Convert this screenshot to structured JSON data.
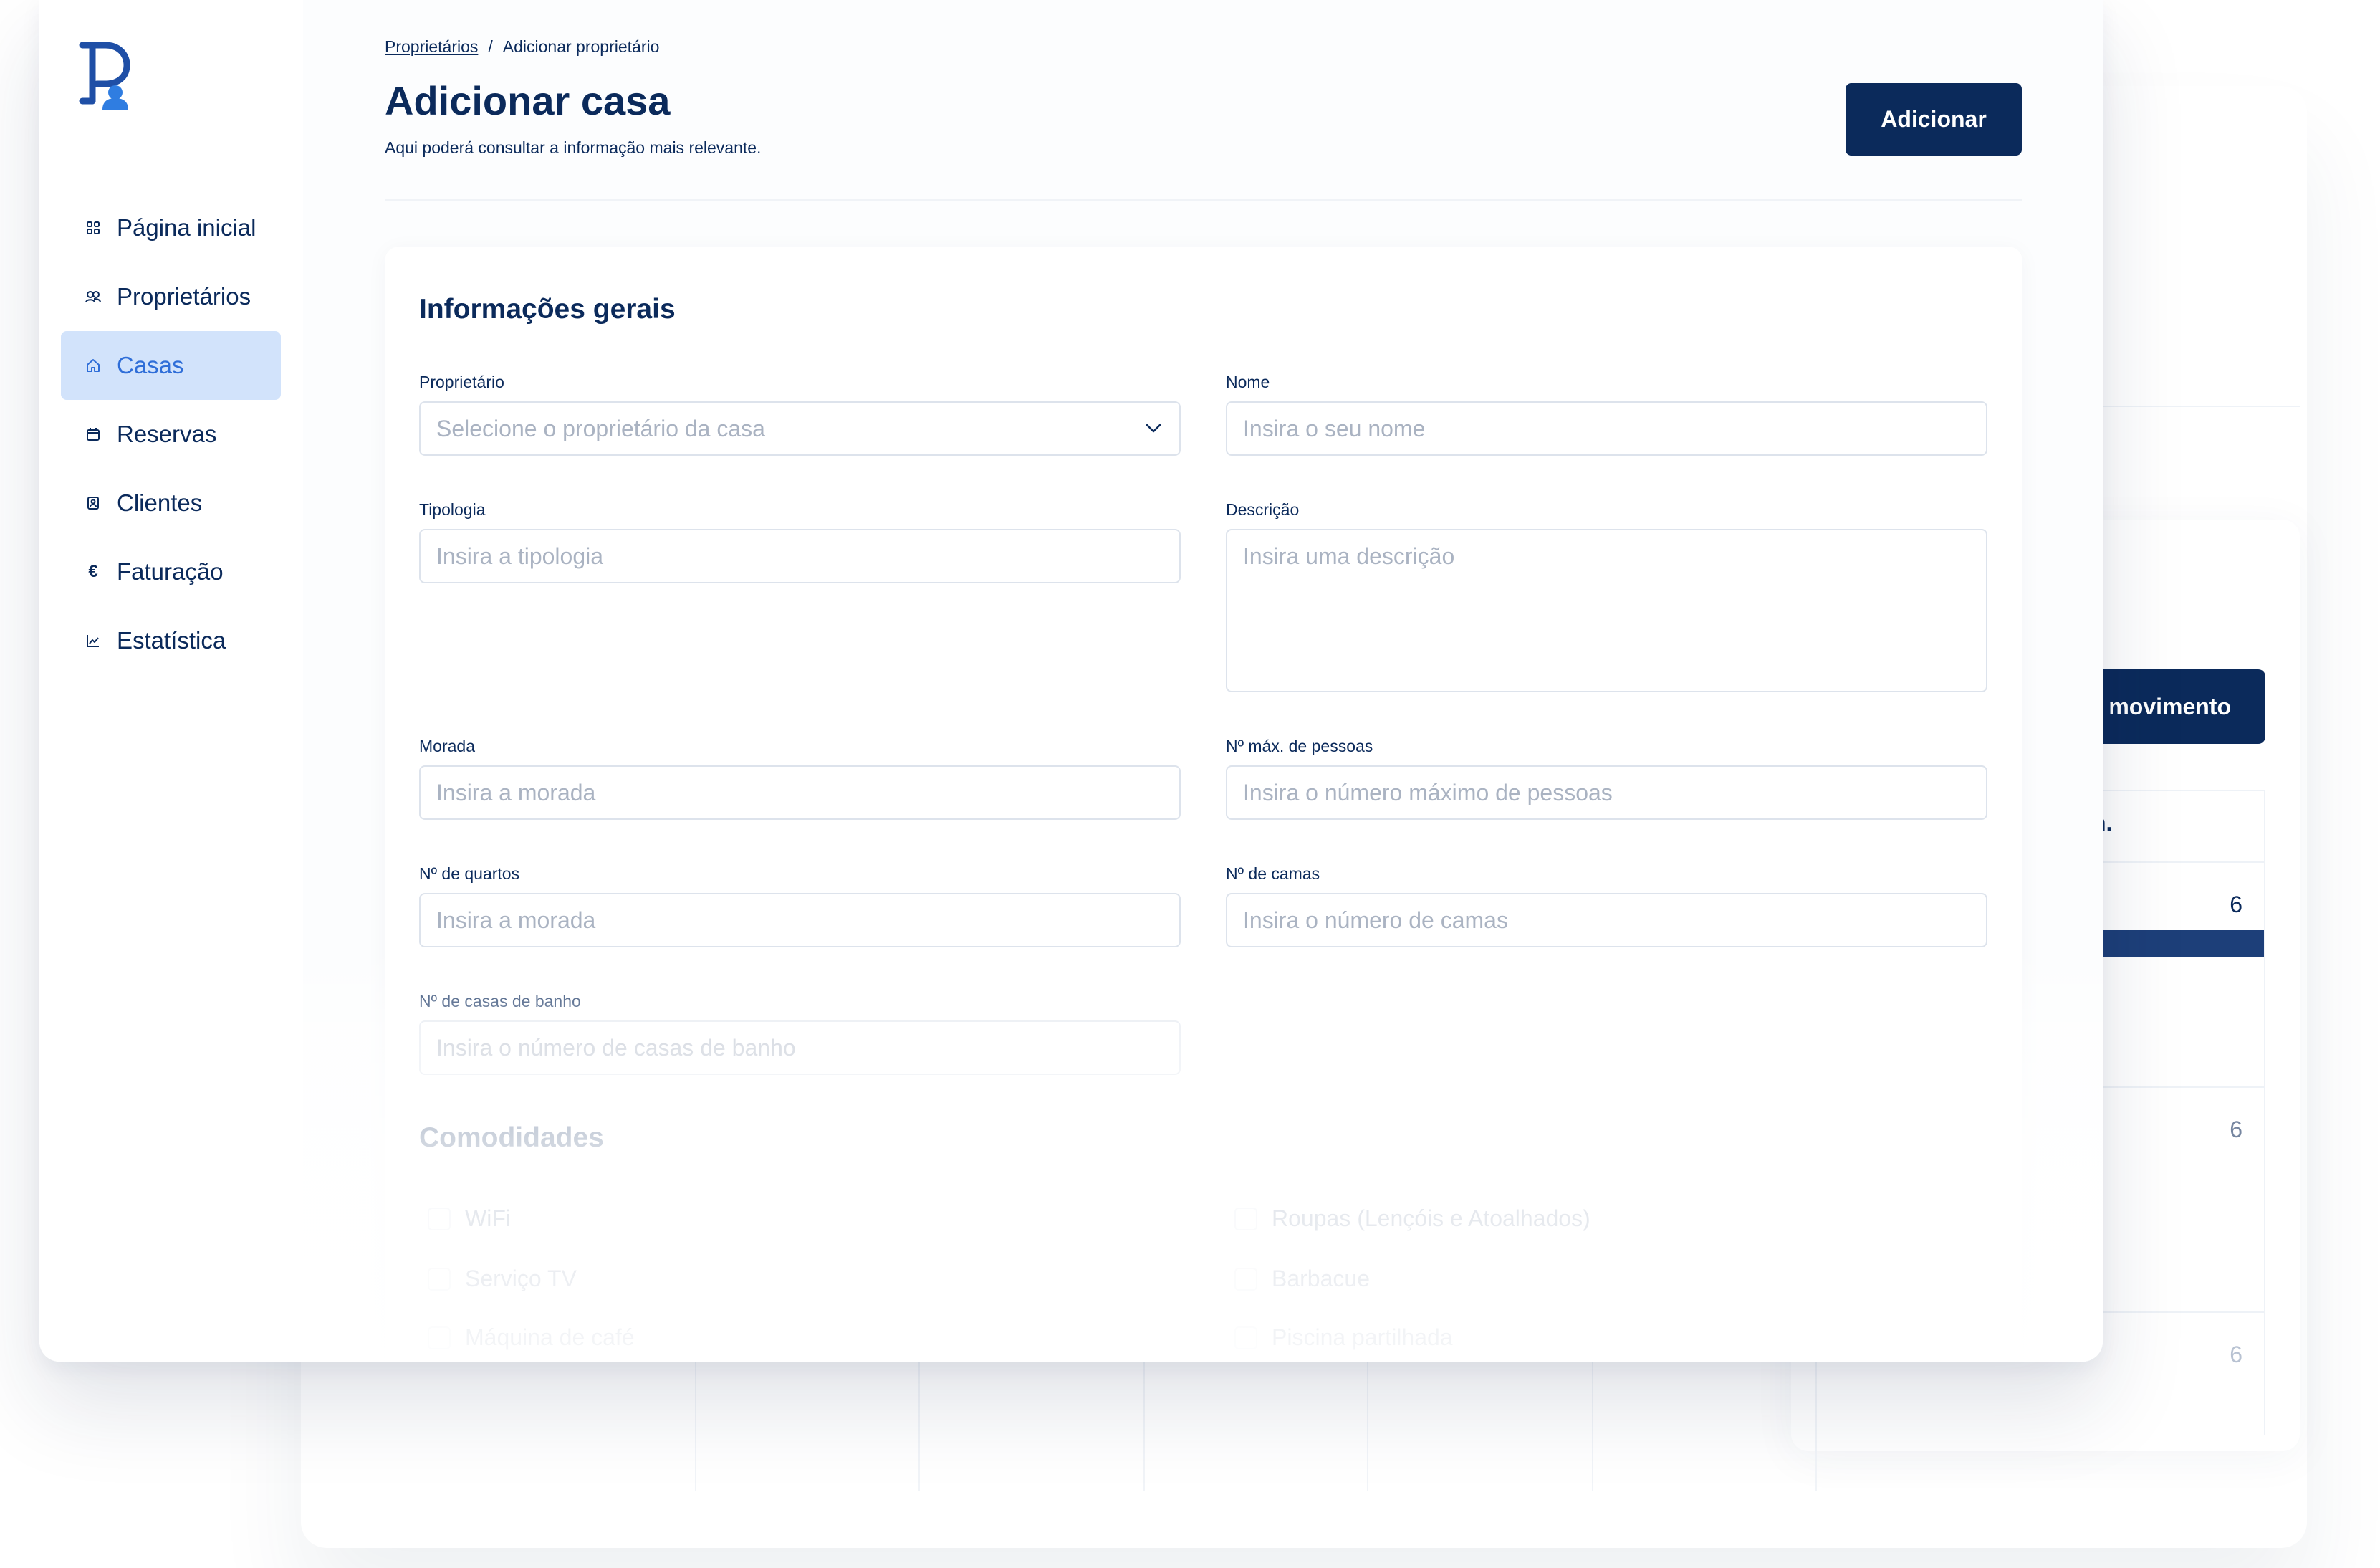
{
  "background_window": {
    "button_label": "movimento",
    "table_header": "n.",
    "values": [
      "6",
      "6",
      "6"
    ]
  },
  "sidebar": {
    "items": [
      {
        "label": "Página inicial",
        "icon": "grid-icon",
        "active": false
      },
      {
        "label": "Proprietários",
        "icon": "users-icon",
        "active": false
      },
      {
        "label": "Casas",
        "icon": "home-icon",
        "active": true
      },
      {
        "label": "Reservas",
        "icon": "calendar-icon",
        "active": false
      },
      {
        "label": "Clientes",
        "icon": "contact-book-icon",
        "active": false
      },
      {
        "label": "Faturação",
        "icon": "euro-icon",
        "active": false
      },
      {
        "label": "Estatística",
        "icon": "line-chart-icon",
        "active": false
      }
    ]
  },
  "breadcrumb": {
    "parent": "Proprietários",
    "separator": "/",
    "current": "Adicionar proprietário"
  },
  "header": {
    "title": "Adicionar casa",
    "subtitle": "Aqui poderá consultar a informação mais relevante.",
    "add_button": "Adicionar"
  },
  "form": {
    "section_title": "Informações gerais",
    "owner": {
      "label": "Proprietário",
      "placeholder": "Selecione o proprietário da casa"
    },
    "name": {
      "label": "Nome",
      "placeholder": "Insira o seu nome"
    },
    "typology": {
      "label": "Tipologia",
      "placeholder": "Insira a tipologia"
    },
    "description": {
      "label": "Descrição",
      "placeholder": "Insira uma descrição"
    },
    "address": {
      "label": "Morada",
      "placeholder": "Insira a morada"
    },
    "max_people": {
      "label": "Nº máx. de pessoas",
      "placeholder": "Insira o número máximo de pessoas"
    },
    "rooms": {
      "label": "Nº de quartos",
      "placeholder": "Insira a morada"
    },
    "beds": {
      "label": "Nº de camas",
      "placeholder": "Insira o número de camas"
    },
    "bathrooms": {
      "label": "Nº de casas de banho",
      "placeholder": "Insira o número de casas de banho"
    }
  },
  "amenities": {
    "title": "Comodidades",
    "items": [
      "WiFi",
      "Roupas (Lençóis e Atoalhados)",
      "Serviço TV",
      "Barbacue",
      "Máquina de café",
      "Piscina partilhada"
    ]
  },
  "colors": {
    "primary": "#0b2a5b",
    "active_bg": "#d2e3fb",
    "active_text": "#2f6ed8",
    "logo_blue": "#2f7de1"
  }
}
